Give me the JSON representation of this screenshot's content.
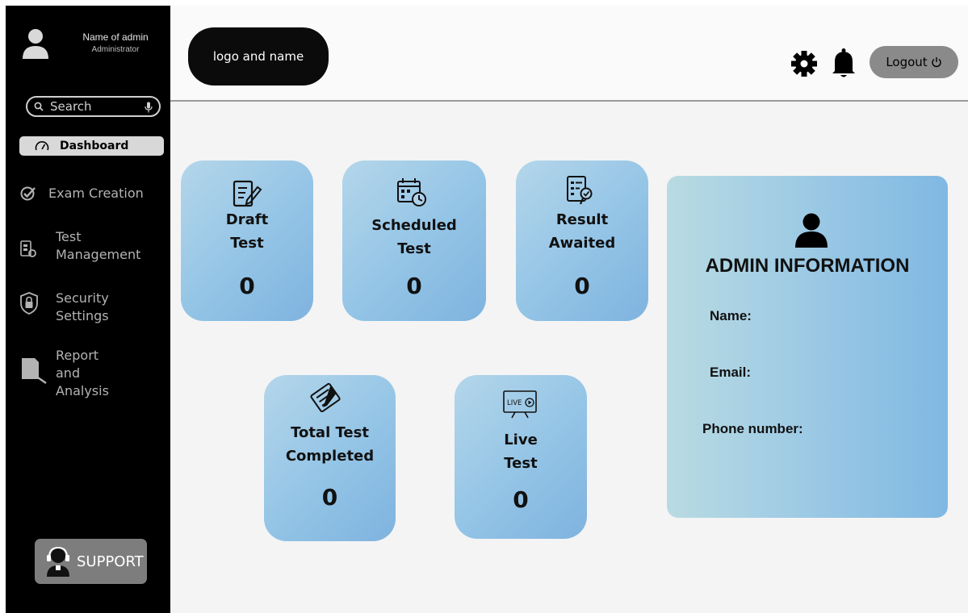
{
  "sidebar": {
    "profile": {
      "name": "Name of admin",
      "role": "Administrator"
    },
    "search": {
      "placeholder": "Search"
    },
    "items": [
      {
        "label": "Dashboard",
        "active": true,
        "icon": "speedometer-icon"
      },
      {
        "label": "Exam Creation",
        "icon": "check-circle-icon"
      },
      {
        "label": "Test\nManagement",
        "icon": "gear-document-icon"
      },
      {
        "label": "Security\nSettings",
        "icon": "shield-lock-icon"
      },
      {
        "label": "Report and\nAnalysis",
        "icon": "report-icon"
      }
    ],
    "support": {
      "label": "SUPPORT",
      "icon": "headset-user-icon"
    }
  },
  "header": {
    "logo_label": "logo and name",
    "logout_label": "Logout",
    "icons": [
      "gear-icon",
      "bell-icon",
      "power-icon"
    ]
  },
  "cards": [
    {
      "id": "draft",
      "title": "Draft\nTest",
      "count": "0",
      "icon": "draft-document-icon"
    },
    {
      "id": "scheduled",
      "title": "Scheduled\nTest",
      "count": "0",
      "icon": "calendar-clock-icon"
    },
    {
      "id": "result",
      "title": "Result\nAwaited",
      "count": "0",
      "icon": "result-check-icon"
    },
    {
      "id": "completed",
      "title": "Total Test\nCompleted",
      "count": "0",
      "icon": "completed-test-icon"
    },
    {
      "id": "live",
      "title": "Live\nTest",
      "count": "0",
      "icon": "live-tv-icon",
      "badge": "LIVE"
    }
  ],
  "admin_info": {
    "heading": "ADMIN INFORMATION",
    "fields": [
      "Name:",
      "Email:",
      "Phone number:"
    ]
  },
  "colors": {
    "sidebar_bg": "#000000",
    "card_gradient_start": "#b4d6ea",
    "card_gradient_end": "#7fb3df",
    "button_gray": "#8a8a8a"
  }
}
